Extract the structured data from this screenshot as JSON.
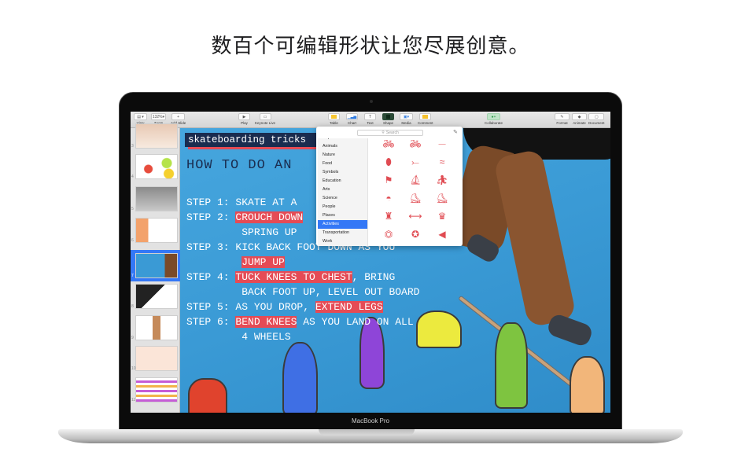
{
  "headline": "数百个可编辑形状让您尽展创意。",
  "device": {
    "brand_label": "MacBook Pro"
  },
  "toolbar": {
    "left": [
      {
        "id": "view",
        "label": "View",
        "icon": "sidebar-icon"
      },
      {
        "id": "zoom",
        "label": "Zoom",
        "value": "132%"
      },
      {
        "id": "add-slide",
        "label": "Add Slide",
        "icon": "plus-icon"
      }
    ],
    "center_left": [
      {
        "id": "play",
        "label": "Play",
        "icon": "play-icon"
      },
      {
        "id": "keynote-live",
        "label": "Keynote Live",
        "icon": "keynote-live-icon"
      }
    ],
    "insert": [
      {
        "id": "table",
        "label": "Table",
        "icon": "table-icon"
      },
      {
        "id": "chart",
        "label": "Chart",
        "icon": "chart-icon"
      },
      {
        "id": "text",
        "label": "Text",
        "icon": "text-icon"
      },
      {
        "id": "shape",
        "label": "Shape",
        "icon": "shape-icon"
      },
      {
        "id": "media",
        "label": "Media",
        "icon": "media-icon"
      },
      {
        "id": "comment",
        "label": "Comment",
        "icon": "comment-icon"
      }
    ],
    "collaborate": {
      "label": "Collaborate",
      "icon": "collaborate-icon"
    },
    "right": [
      {
        "id": "format",
        "label": "Format",
        "icon": "format-icon"
      },
      {
        "id": "animate",
        "label": "Animate",
        "icon": "animate-icon"
      },
      {
        "id": "document",
        "label": "Document",
        "icon": "document-icon"
      }
    ]
  },
  "sidebar": {
    "slides": [
      {
        "num": "3"
      },
      {
        "num": "4"
      },
      {
        "num": "5"
      },
      {
        "num": "6"
      },
      {
        "num": "7",
        "selected": true
      },
      {
        "num": "8"
      },
      {
        "num": "9"
      },
      {
        "num": "10"
      },
      {
        "num": "11"
      }
    ]
  },
  "slide": {
    "title": "skateboarding tricks",
    "heading": "HOW TO DO AN",
    "steps": [
      {
        "label": "STEP 1:",
        "lines": [
          [
            {
              "t": "SKATE AT A"
            }
          ]
        ]
      },
      {
        "label": "STEP 2:",
        "lines": [
          [
            {
              "t": "CROUCH DOWN",
              "hl": true
            }
          ],
          [
            {
              "t": "SPRING UP"
            }
          ]
        ]
      },
      {
        "label": "STEP 3:",
        "lines": [
          [
            {
              "t": "KICK BACK FOOT DOWN AS YOU"
            }
          ],
          [
            {
              "t": "JUMP UP",
              "hl": true
            }
          ]
        ]
      },
      {
        "label": "STEP 4:",
        "lines": [
          [
            {
              "t": "TUCK KNEES TO CHEST",
              "hl": true
            },
            {
              "t": ", BRING"
            }
          ],
          [
            {
              "t": "BACK FOOT UP, LEVEL OUT BOARD"
            }
          ]
        ]
      },
      {
        "label": "STEP 5:",
        "lines": [
          [
            {
              "t": "AS YOU DROP, "
            },
            {
              "t": "EXTEND LEGS",
              "hl": true
            }
          ]
        ]
      },
      {
        "label": "STEP 6:",
        "lines": [
          [
            {
              "t": "BEND KNEES",
              "hl": true
            },
            {
              "t": " AS YOU LAND ON ALL"
            }
          ],
          [
            {
              "t": "4 WHEELS"
            }
          ]
        ]
      }
    ],
    "highlight_color": "#e54b55"
  },
  "shape_popover": {
    "search_placeholder": "Search",
    "categories": [
      "Objects",
      "Animals",
      "Nature",
      "Food",
      "Symbols",
      "Education",
      "Arts",
      "Science",
      "People",
      "Places",
      "Activities",
      "Transportation",
      "Work"
    ],
    "selected_category": "Activities",
    "shapes": [
      "bicycle",
      "bicycle",
      "skateboard",
      "surfboard",
      "rowing",
      "swimmer",
      "golf-flag",
      "sailboat",
      "hiker",
      "ufo-frisbee",
      "inline-skate",
      "roller-skate",
      "bowling-pin",
      "dumbbell",
      "trophy",
      "medal",
      "ribbon-award",
      "megaphone"
    ],
    "shape_color": "#e04b52"
  }
}
